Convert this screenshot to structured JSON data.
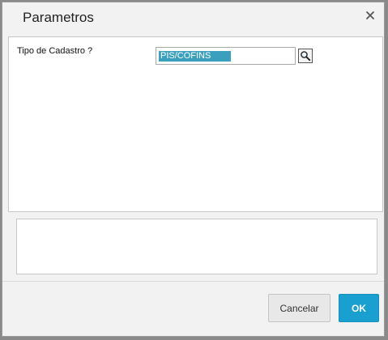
{
  "dialog": {
    "title": "Parametros"
  },
  "form": {
    "fields": [
      {
        "label": "Tipo de Cadastro ?",
        "value": "PIS/COFINS"
      }
    ]
  },
  "footer": {
    "cancel_label": "Cancelar",
    "ok_label": "OK"
  },
  "colors": {
    "ok_button": "#199fd0",
    "selection": "#3aa0bd"
  },
  "icons": {
    "close": "close-icon",
    "lookup": "search-icon"
  }
}
